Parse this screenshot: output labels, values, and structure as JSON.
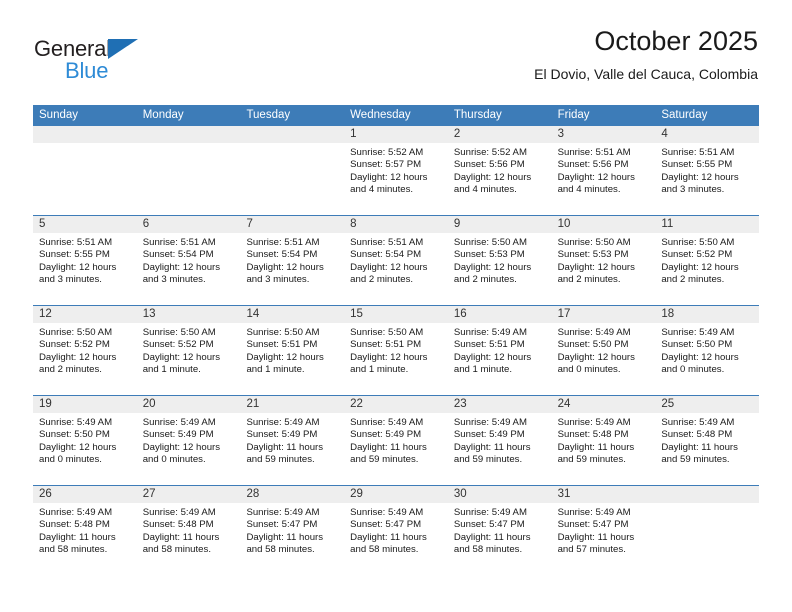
{
  "brand": {
    "name_top": "General",
    "name_bottom": "Blue",
    "color_dark": "#231f20",
    "color_blue": "#2e8bd6",
    "triangle_color": "#1f6fb4"
  },
  "header": {
    "title": "October 2025",
    "subtitle": "El Dovio, Valle del Cauca, Colombia"
  },
  "theme": {
    "header_bar": "#3d7cb8",
    "day_strip": "#eeeeee",
    "text": "#1a1a1a"
  },
  "weekdays": [
    "Sunday",
    "Monday",
    "Tuesday",
    "Wednesday",
    "Thursday",
    "Friday",
    "Saturday"
  ],
  "weeks": [
    [
      {
        "day": "",
        "empty": true,
        "sunrise": "",
        "sunset": "",
        "daylight": ""
      },
      {
        "day": "",
        "empty": true,
        "sunrise": "",
        "sunset": "",
        "daylight": ""
      },
      {
        "day": "",
        "empty": true,
        "sunrise": "",
        "sunset": "",
        "daylight": ""
      },
      {
        "day": "1",
        "sunrise": "Sunrise: 5:52 AM",
        "sunset": "Sunset: 5:57 PM",
        "daylight": "Daylight: 12 hours and 4 minutes."
      },
      {
        "day": "2",
        "sunrise": "Sunrise: 5:52 AM",
        "sunset": "Sunset: 5:56 PM",
        "daylight": "Daylight: 12 hours and 4 minutes."
      },
      {
        "day": "3",
        "sunrise": "Sunrise: 5:51 AM",
        "sunset": "Sunset: 5:56 PM",
        "daylight": "Daylight: 12 hours and 4 minutes."
      },
      {
        "day": "4",
        "sunrise": "Sunrise: 5:51 AM",
        "sunset": "Sunset: 5:55 PM",
        "daylight": "Daylight: 12 hours and 3 minutes."
      }
    ],
    [
      {
        "day": "5",
        "sunrise": "Sunrise: 5:51 AM",
        "sunset": "Sunset: 5:55 PM",
        "daylight": "Daylight: 12 hours and 3 minutes."
      },
      {
        "day": "6",
        "sunrise": "Sunrise: 5:51 AM",
        "sunset": "Sunset: 5:54 PM",
        "daylight": "Daylight: 12 hours and 3 minutes."
      },
      {
        "day": "7",
        "sunrise": "Sunrise: 5:51 AM",
        "sunset": "Sunset: 5:54 PM",
        "daylight": "Daylight: 12 hours and 3 minutes."
      },
      {
        "day": "8",
        "sunrise": "Sunrise: 5:51 AM",
        "sunset": "Sunset: 5:54 PM",
        "daylight": "Daylight: 12 hours and 2 minutes."
      },
      {
        "day": "9",
        "sunrise": "Sunrise: 5:50 AM",
        "sunset": "Sunset: 5:53 PM",
        "daylight": "Daylight: 12 hours and 2 minutes."
      },
      {
        "day": "10",
        "sunrise": "Sunrise: 5:50 AM",
        "sunset": "Sunset: 5:53 PM",
        "daylight": "Daylight: 12 hours and 2 minutes."
      },
      {
        "day": "11",
        "sunrise": "Sunrise: 5:50 AM",
        "sunset": "Sunset: 5:52 PM",
        "daylight": "Daylight: 12 hours and 2 minutes."
      }
    ],
    [
      {
        "day": "12",
        "sunrise": "Sunrise: 5:50 AM",
        "sunset": "Sunset: 5:52 PM",
        "daylight": "Daylight: 12 hours and 2 minutes."
      },
      {
        "day": "13",
        "sunrise": "Sunrise: 5:50 AM",
        "sunset": "Sunset: 5:52 PM",
        "daylight": "Daylight: 12 hours and 1 minute."
      },
      {
        "day": "14",
        "sunrise": "Sunrise: 5:50 AM",
        "sunset": "Sunset: 5:51 PM",
        "daylight": "Daylight: 12 hours and 1 minute."
      },
      {
        "day": "15",
        "sunrise": "Sunrise: 5:50 AM",
        "sunset": "Sunset: 5:51 PM",
        "daylight": "Daylight: 12 hours and 1 minute."
      },
      {
        "day": "16",
        "sunrise": "Sunrise: 5:49 AM",
        "sunset": "Sunset: 5:51 PM",
        "daylight": "Daylight: 12 hours and 1 minute."
      },
      {
        "day": "17",
        "sunrise": "Sunrise: 5:49 AM",
        "sunset": "Sunset: 5:50 PM",
        "daylight": "Daylight: 12 hours and 0 minutes."
      },
      {
        "day": "18",
        "sunrise": "Sunrise: 5:49 AM",
        "sunset": "Sunset: 5:50 PM",
        "daylight": "Daylight: 12 hours and 0 minutes."
      }
    ],
    [
      {
        "day": "19",
        "sunrise": "Sunrise: 5:49 AM",
        "sunset": "Sunset: 5:50 PM",
        "daylight": "Daylight: 12 hours and 0 minutes."
      },
      {
        "day": "20",
        "sunrise": "Sunrise: 5:49 AM",
        "sunset": "Sunset: 5:49 PM",
        "daylight": "Daylight: 12 hours and 0 minutes."
      },
      {
        "day": "21",
        "sunrise": "Sunrise: 5:49 AM",
        "sunset": "Sunset: 5:49 PM",
        "daylight": "Daylight: 11 hours and 59 minutes."
      },
      {
        "day": "22",
        "sunrise": "Sunrise: 5:49 AM",
        "sunset": "Sunset: 5:49 PM",
        "daylight": "Daylight: 11 hours and 59 minutes."
      },
      {
        "day": "23",
        "sunrise": "Sunrise: 5:49 AM",
        "sunset": "Sunset: 5:49 PM",
        "daylight": "Daylight: 11 hours and 59 minutes."
      },
      {
        "day": "24",
        "sunrise": "Sunrise: 5:49 AM",
        "sunset": "Sunset: 5:48 PM",
        "daylight": "Daylight: 11 hours and 59 minutes."
      },
      {
        "day": "25",
        "sunrise": "Sunrise: 5:49 AM",
        "sunset": "Sunset: 5:48 PM",
        "daylight": "Daylight: 11 hours and 59 minutes."
      }
    ],
    [
      {
        "day": "26",
        "sunrise": "Sunrise: 5:49 AM",
        "sunset": "Sunset: 5:48 PM",
        "daylight": "Daylight: 11 hours and 58 minutes."
      },
      {
        "day": "27",
        "sunrise": "Sunrise: 5:49 AM",
        "sunset": "Sunset: 5:48 PM",
        "daylight": "Daylight: 11 hours and 58 minutes."
      },
      {
        "day": "28",
        "sunrise": "Sunrise: 5:49 AM",
        "sunset": "Sunset: 5:47 PM",
        "daylight": "Daylight: 11 hours and 58 minutes."
      },
      {
        "day": "29",
        "sunrise": "Sunrise: 5:49 AM",
        "sunset": "Sunset: 5:47 PM",
        "daylight": "Daylight: 11 hours and 58 minutes."
      },
      {
        "day": "30",
        "sunrise": "Sunrise: 5:49 AM",
        "sunset": "Sunset: 5:47 PM",
        "daylight": "Daylight: 11 hours and 58 minutes."
      },
      {
        "day": "31",
        "sunrise": "Sunrise: 5:49 AM",
        "sunset": "Sunset: 5:47 PM",
        "daylight": "Daylight: 11 hours and 57 minutes."
      },
      {
        "day": "",
        "empty": true,
        "sunrise": "",
        "sunset": "",
        "daylight": ""
      }
    ]
  ]
}
